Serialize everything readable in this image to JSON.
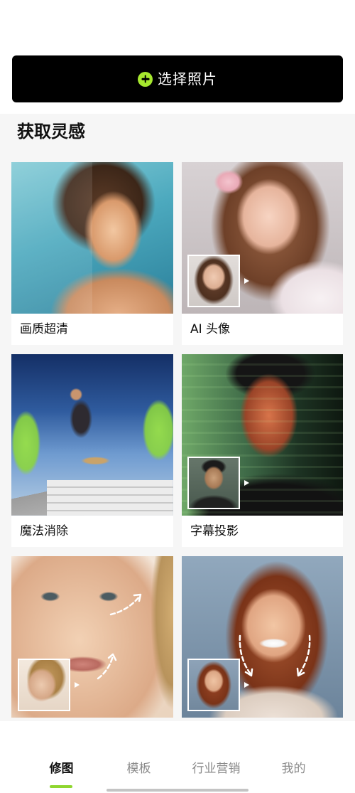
{
  "header": {
    "select_photo_label": "选择照片",
    "select_photo_icon": "plus-circle-icon"
  },
  "inspiration": {
    "title": "获取灵感",
    "cards": [
      {
        "label": "画质超清"
      },
      {
        "label": "AI 头像"
      },
      {
        "label": "魔法消除"
      },
      {
        "label": "字幕投影"
      }
    ]
  },
  "tab_bar": {
    "tabs": [
      {
        "label": "修图",
        "active": true
      },
      {
        "label": "模板",
        "active": false
      },
      {
        "label": "行业营销",
        "active": false
      },
      {
        "label": "我的",
        "active": false
      }
    ]
  },
  "colors": {
    "button_bg": "#000000",
    "icon_green": "#a6e82e",
    "accent_green": "#8fd62f",
    "active_tab_text": "#111111",
    "inactive_tab_text": "#8a8a8a"
  }
}
